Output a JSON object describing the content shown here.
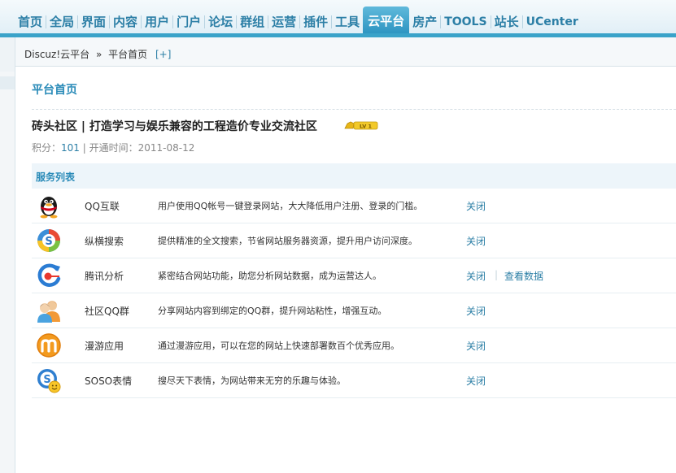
{
  "nav": {
    "items": [
      {
        "label": "首页"
      },
      {
        "label": "全局"
      },
      {
        "label": "界面"
      },
      {
        "label": "内容"
      },
      {
        "label": "用户"
      },
      {
        "label": "门户"
      },
      {
        "label": "论坛"
      },
      {
        "label": "群组"
      },
      {
        "label": "运营"
      },
      {
        "label": "插件"
      },
      {
        "label": "工具"
      },
      {
        "label": "云平台",
        "active": true
      },
      {
        "label": "房产"
      },
      {
        "label": "TOOLS"
      },
      {
        "label": "站长"
      },
      {
        "label": "UCenter"
      }
    ]
  },
  "breadcrumb": {
    "root": "Discuz!云平台",
    "sep": "»",
    "current": "平台首页",
    "add": "[+]"
  },
  "page": {
    "title": "平台首页"
  },
  "site": {
    "name": "砖头社区 | 打造学习与娱乐兼容的工程造价专业交流社区",
    "level_badge": "LV 1",
    "score_label": "积分：",
    "score": "101",
    "divider": " | ",
    "open_time": "开通时间：2011-08-12"
  },
  "services": {
    "title": "服务列表",
    "rows": [
      {
        "name": "QQ互联",
        "icon": "qq-penguin-icon",
        "desc": "用户使用QQ帐号一键登录网站，大大降低用户注册、登录的门槛。",
        "action": "关闭"
      },
      {
        "name": "纵横搜索",
        "icon": "soso-search-icon",
        "desc": "提供精准的全文搜索，节省网站服务器资源，提升用户访问深度。",
        "action": "关闭"
      },
      {
        "name": "腾讯分析",
        "icon": "analytics-icon",
        "desc": "紧密结合网站功能，助您分析网站数据，成为运营达人。",
        "action": "关闭",
        "action_sep": "|",
        "action2": "查看数据"
      },
      {
        "name": "社区QQ群",
        "icon": "qq-group-icon",
        "desc": "分享网站内容到绑定的QQ群，提升网站粘性，增强互动。",
        "action": "关闭"
      },
      {
        "name": "漫游应用",
        "icon": "manyou-icon",
        "desc": "通过漫游应用，可以在您的网站上快速部署数百个优秀应用。",
        "action": "关闭"
      },
      {
        "name": "SOSO表情",
        "icon": "soso-emoticon-icon",
        "desc": "搜尽天下表情，为网站带来无穷的乐趣与体验。",
        "action": "关闭"
      }
    ]
  },
  "colors": {
    "accent": "#2a8bb8",
    "nav_active": "#3aa3c9",
    "link": "#2c7fa6"
  }
}
